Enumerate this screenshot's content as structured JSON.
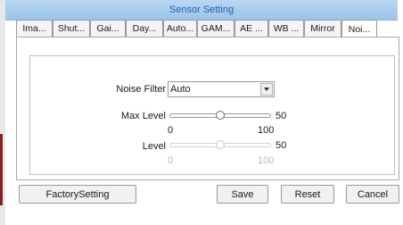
{
  "title": "Sensor Setting",
  "tabs": [
    {
      "label": "Ima...",
      "active": false
    },
    {
      "label": "Shut...",
      "active": false
    },
    {
      "label": "Gai...",
      "active": false
    },
    {
      "label": "Day...",
      "active": false
    },
    {
      "label": "Auto...",
      "active": false
    },
    {
      "label": "GAM...",
      "active": false
    },
    {
      "label": "AE ...",
      "active": false
    },
    {
      "label": "WB ...",
      "active": false
    },
    {
      "label": "Mirror",
      "active": false
    },
    {
      "label": "Noi...",
      "active": true
    }
  ],
  "noise_filter": {
    "label": "Noise Filter",
    "value": "Auto"
  },
  "max_level": {
    "label": "Max Level",
    "value": "50",
    "min": "0",
    "max": "100",
    "fraction": 0.5,
    "enabled": true
  },
  "level": {
    "label": "Level",
    "value": "50",
    "min": "0",
    "max": "100",
    "fraction": 0.5,
    "enabled": false
  },
  "buttons": {
    "factory": "FactorySetting",
    "save": "Save",
    "reset": "Reset",
    "cancel": "Cancel"
  },
  "colors": {
    "title_text": "#1f5fb0",
    "title_bg": "#a9cdee"
  }
}
